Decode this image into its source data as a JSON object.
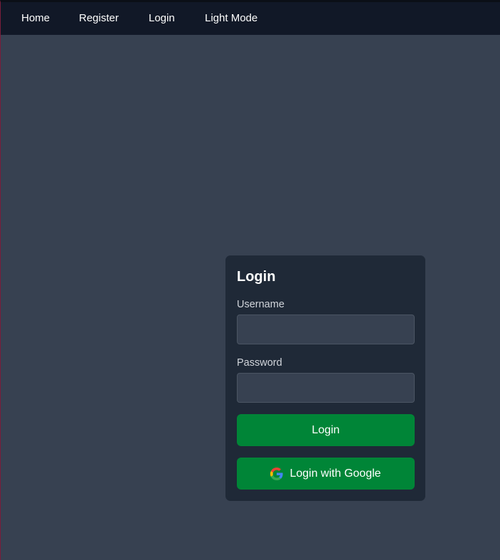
{
  "nav": {
    "items": [
      {
        "label": "Home"
      },
      {
        "label": "Register"
      },
      {
        "label": "Login"
      },
      {
        "label": "Light Mode"
      }
    ]
  },
  "login_card": {
    "title": "Login",
    "username_label": "Username",
    "username_value": "",
    "password_label": "Password",
    "password_value": "",
    "login_button": "Login",
    "google_button": "Login with Google"
  },
  "colors": {
    "background": "#374151",
    "navbar": "#111827",
    "card": "#1f2937",
    "button": "#008537"
  },
  "icons": {
    "google": "google-icon"
  }
}
